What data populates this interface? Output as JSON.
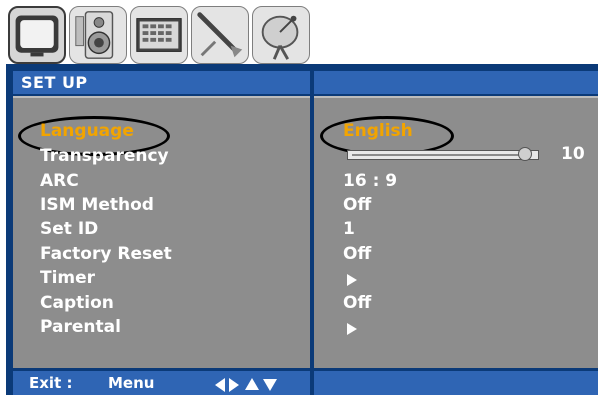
{
  "tabs": [
    {
      "icon": "tv-screen-icon",
      "active": true
    },
    {
      "icon": "speaker-icon",
      "active": false
    },
    {
      "icon": "channel-grid-icon",
      "active": false
    },
    {
      "icon": "tools-icon",
      "active": false
    },
    {
      "icon": "satellite-dish-icon",
      "active": false
    }
  ],
  "menu": {
    "title": "SET UP",
    "items": [
      {
        "label": "Language",
        "value": "English",
        "selected": true
      },
      {
        "label": "Transparency",
        "value": "10",
        "control": "slider",
        "level": 10
      },
      {
        "label": "ARC",
        "value": "16 : 9"
      },
      {
        "label": "ISM Method",
        "value": "Off"
      },
      {
        "label": "Set ID",
        "value": "1"
      },
      {
        "label": "Factory Reset",
        "value": "Off"
      },
      {
        "label": "Timer",
        "value": "",
        "control": "submenu-arrow"
      },
      {
        "label": "Caption",
        "value": "Off"
      },
      {
        "label": "Parental",
        "value": "",
        "control": "submenu-arrow"
      }
    ]
  },
  "footer": {
    "exit_label": "Exit :",
    "exit_key": "Menu",
    "nav_icons": [
      "arrow-left-icon",
      "arrow-right-icon",
      "arrow-up-icon",
      "arrow-down-icon"
    ]
  },
  "colors": {
    "selected_text": "#f2a400",
    "panel_bg": "#8d8d8d",
    "header_bg": "#2f65b4",
    "frame_bg": "#0b3a78"
  }
}
